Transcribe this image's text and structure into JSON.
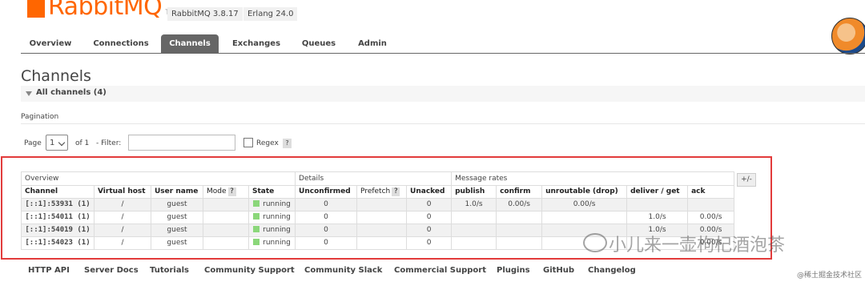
{
  "header": {
    "logo_text": "RabbitMQ",
    "logo_tm": "TM",
    "version": "RabbitMQ 3.8.17",
    "erlang": "Erlang 24.0"
  },
  "tabs": [
    "Overview",
    "Connections",
    "Channels",
    "Exchanges",
    "Queues",
    "Admin"
  ],
  "active_tab": "Channels",
  "page_title": "Channels",
  "section_label": "All channels (4)",
  "pagination": {
    "label": "Pagination",
    "page_label": "Page",
    "page_value": "1",
    "of_label": "of 1",
    "filter_label": "- Filter:",
    "filter_value": "",
    "regex_label": "Regex",
    "help": "?"
  },
  "table": {
    "groups": [
      "Overview",
      "Details",
      "Message rates"
    ],
    "plus_minus": "+/-",
    "columns": [
      "Channel",
      "Virtual host",
      "User name",
      "Mode",
      "State",
      "Unconfirmed",
      "Prefetch",
      "Unacked",
      "publish",
      "confirm",
      "unroutable (drop)",
      "deliver / get",
      "ack"
    ],
    "rows": [
      {
        "channel": "[::1]:53931 (1)",
        "vhost": "/",
        "user": "guest",
        "mode": "",
        "state": "running",
        "unconfirmed": "0",
        "prefetch": "",
        "unacked": "0",
        "publish": "1.0/s",
        "confirm": "0.00/s",
        "unroutable": "0.00/s",
        "deliver_get": "",
        "ack": ""
      },
      {
        "channel": "[::1]:54011 (1)",
        "vhost": "/",
        "user": "guest",
        "mode": "",
        "state": "running",
        "unconfirmed": "0",
        "prefetch": "",
        "unacked": "0",
        "publish": "",
        "confirm": "",
        "unroutable": "",
        "deliver_get": "1.0/s",
        "ack": "0.00/s"
      },
      {
        "channel": "[::1]:54019 (1)",
        "vhost": "/",
        "user": "guest",
        "mode": "",
        "state": "running",
        "unconfirmed": "0",
        "prefetch": "",
        "unacked": "0",
        "publish": "",
        "confirm": "",
        "unroutable": "",
        "deliver_get": "1.0/s",
        "ack": "0.00/s"
      },
      {
        "channel": "[::1]:54023 (1)",
        "vhost": "/",
        "user": "guest",
        "mode": "",
        "state": "running",
        "unconfirmed": "0",
        "prefetch": "",
        "unacked": "0",
        "publish": "",
        "confirm": "",
        "unroutable": "",
        "deliver_get": "",
        "ack": "0.00/s"
      }
    ]
  },
  "footer": [
    "HTTP API",
    "Server Docs",
    "Tutorials",
    "Community Support",
    "Community Slack",
    "Commercial Support",
    "Plugins",
    "GitHub",
    "Changelog"
  ],
  "watermark": "小儿来一壶枸杞酒泡茶",
  "watermark_small": "@稀土掘金技术社区",
  "colors": {
    "brand": "#ff6600",
    "running": "#8bd77a",
    "highlight": "#e23b3b"
  }
}
